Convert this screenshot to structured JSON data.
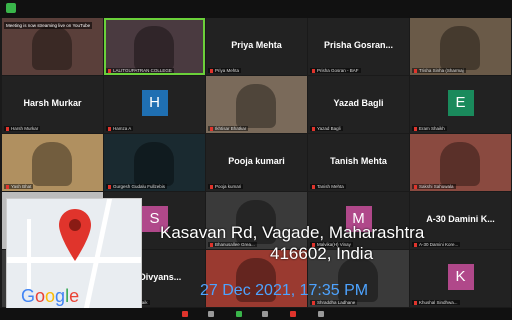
{
  "streaming_banner": "Meeting is now streaming live on YouTube",
  "tiles": [
    {
      "name": "",
      "label": "",
      "type": "video"
    },
    {
      "name": "",
      "label": "LALITGUPATRAN COLLEGE",
      "type": "video"
    },
    {
      "name": "Priya Mehta",
      "label": "Priya Mehta",
      "type": "name"
    },
    {
      "name": "Prisha Gosran...",
      "label": "Prisha Gosran - BAF",
      "type": "name"
    },
    {
      "name": "",
      "label": "Trisha Sinha (Sharmaj",
      "type": "video"
    },
    {
      "name": "Harsh Murkar",
      "label": "Harsh Murkar",
      "type": "name"
    },
    {
      "name": "",
      "label": "Hamza A",
      "type": "avatar",
      "letter": "H",
      "color": "#1f6fb2"
    },
    {
      "name": "",
      "label": "Ikhtisar Bhatkar",
      "type": "video"
    },
    {
      "name": "Yazad Bagli",
      "label": "Yazad Bagli",
      "type": "name"
    },
    {
      "name": "",
      "label": "Eram Shaikh",
      "type": "avatar",
      "letter": "E",
      "color": "#1a8a5c"
    },
    {
      "name": "",
      "label": "Yash Bhat",
      "type": "video"
    },
    {
      "name": "",
      "label": "Gurgesh Gudalu Fullzebis",
      "type": "video"
    },
    {
      "name": "Pooja kumari",
      "label": "Pooja kumari",
      "type": "name"
    },
    {
      "name": "Tanish Mehta",
      "label": "Tanish Mehta",
      "type": "name"
    },
    {
      "name": "",
      "label": "Sakshi Sahuwala",
      "type": "video"
    },
    {
      "name": "",
      "label": "",
      "type": "video"
    },
    {
      "name": "",
      "label": "Lalu College",
      "type": "avatar",
      "letter": "S",
      "color": "#b0488a"
    },
    {
      "name": "",
      "label": "Bhanusallee Grea...",
      "type": "video"
    },
    {
      "name": "",
      "label": "Malvika(H) Vinay",
      "type": "avatar",
      "letter": "M",
      "color": "#b0488a"
    },
    {
      "name": "A-30 Damini K...",
      "label": "A-30 Damini Kore...",
      "type": "name"
    },
    {
      "name": "",
      "label": "",
      "type": "video"
    },
    {
      "name": "S- Divyans...",
      "label": "S- Divyansh Naik",
      "type": "name"
    },
    {
      "name": "",
      "label": "",
      "type": "video"
    },
    {
      "name": "",
      "label": "Shraddha Ladhane",
      "type": "video"
    },
    {
      "name": "",
      "label": "Khushal Sindhwa...",
      "type": "avatar",
      "letter": "K",
      "color": "#b0488a"
    }
  ],
  "map_logo": "Google",
  "location": {
    "line1": "Kasavan Rd, Vagade, Maharashtra",
    "line2": "416602, India",
    "datetime": "27 Dec 2021, 17:35 PM"
  }
}
